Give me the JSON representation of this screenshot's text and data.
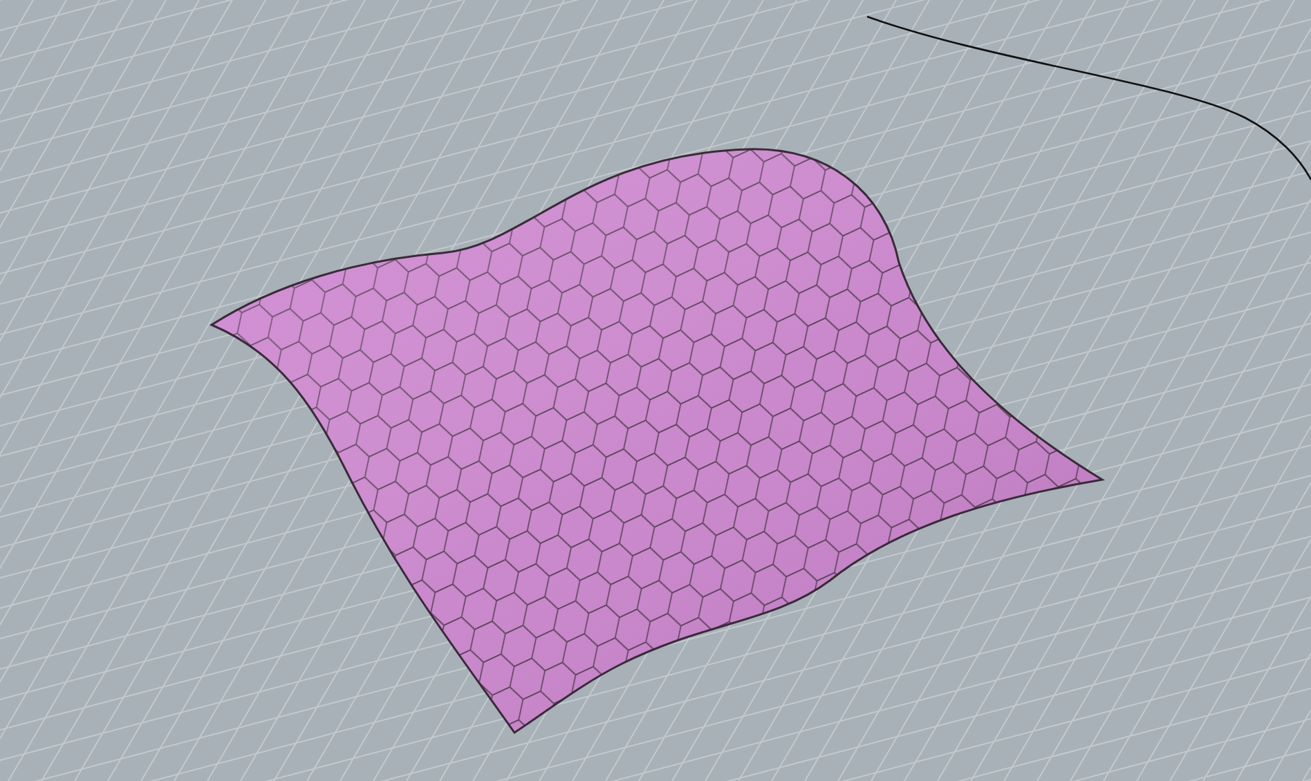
{
  "viewport": {
    "surface": {
      "kind": "hex-panels"
    }
  }
}
